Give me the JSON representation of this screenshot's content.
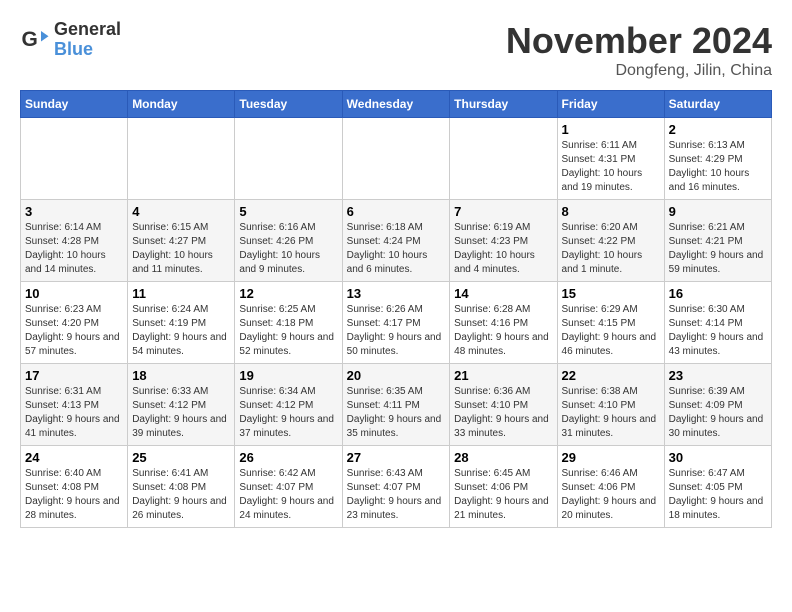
{
  "header": {
    "logo_line1": "General",
    "logo_line2": "Blue",
    "month_title": "November 2024",
    "subtitle": "Dongfeng, Jilin, China"
  },
  "weekdays": [
    "Sunday",
    "Monday",
    "Tuesday",
    "Wednesday",
    "Thursday",
    "Friday",
    "Saturday"
  ],
  "weeks": [
    [
      {
        "day": "",
        "info": ""
      },
      {
        "day": "",
        "info": ""
      },
      {
        "day": "",
        "info": ""
      },
      {
        "day": "",
        "info": ""
      },
      {
        "day": "",
        "info": ""
      },
      {
        "day": "1",
        "info": "Sunrise: 6:11 AM\nSunset: 4:31 PM\nDaylight: 10 hours and 19 minutes."
      },
      {
        "day": "2",
        "info": "Sunrise: 6:13 AM\nSunset: 4:29 PM\nDaylight: 10 hours and 16 minutes."
      }
    ],
    [
      {
        "day": "3",
        "info": "Sunrise: 6:14 AM\nSunset: 4:28 PM\nDaylight: 10 hours and 14 minutes."
      },
      {
        "day": "4",
        "info": "Sunrise: 6:15 AM\nSunset: 4:27 PM\nDaylight: 10 hours and 11 minutes."
      },
      {
        "day": "5",
        "info": "Sunrise: 6:16 AM\nSunset: 4:26 PM\nDaylight: 10 hours and 9 minutes."
      },
      {
        "day": "6",
        "info": "Sunrise: 6:18 AM\nSunset: 4:24 PM\nDaylight: 10 hours and 6 minutes."
      },
      {
        "day": "7",
        "info": "Sunrise: 6:19 AM\nSunset: 4:23 PM\nDaylight: 10 hours and 4 minutes."
      },
      {
        "day": "8",
        "info": "Sunrise: 6:20 AM\nSunset: 4:22 PM\nDaylight: 10 hours and 1 minute."
      },
      {
        "day": "9",
        "info": "Sunrise: 6:21 AM\nSunset: 4:21 PM\nDaylight: 9 hours and 59 minutes."
      }
    ],
    [
      {
        "day": "10",
        "info": "Sunrise: 6:23 AM\nSunset: 4:20 PM\nDaylight: 9 hours and 57 minutes."
      },
      {
        "day": "11",
        "info": "Sunrise: 6:24 AM\nSunset: 4:19 PM\nDaylight: 9 hours and 54 minutes."
      },
      {
        "day": "12",
        "info": "Sunrise: 6:25 AM\nSunset: 4:18 PM\nDaylight: 9 hours and 52 minutes."
      },
      {
        "day": "13",
        "info": "Sunrise: 6:26 AM\nSunset: 4:17 PM\nDaylight: 9 hours and 50 minutes."
      },
      {
        "day": "14",
        "info": "Sunrise: 6:28 AM\nSunset: 4:16 PM\nDaylight: 9 hours and 48 minutes."
      },
      {
        "day": "15",
        "info": "Sunrise: 6:29 AM\nSunset: 4:15 PM\nDaylight: 9 hours and 46 minutes."
      },
      {
        "day": "16",
        "info": "Sunrise: 6:30 AM\nSunset: 4:14 PM\nDaylight: 9 hours and 43 minutes."
      }
    ],
    [
      {
        "day": "17",
        "info": "Sunrise: 6:31 AM\nSunset: 4:13 PM\nDaylight: 9 hours and 41 minutes."
      },
      {
        "day": "18",
        "info": "Sunrise: 6:33 AM\nSunset: 4:12 PM\nDaylight: 9 hours and 39 minutes."
      },
      {
        "day": "19",
        "info": "Sunrise: 6:34 AM\nSunset: 4:12 PM\nDaylight: 9 hours and 37 minutes."
      },
      {
        "day": "20",
        "info": "Sunrise: 6:35 AM\nSunset: 4:11 PM\nDaylight: 9 hours and 35 minutes."
      },
      {
        "day": "21",
        "info": "Sunrise: 6:36 AM\nSunset: 4:10 PM\nDaylight: 9 hours and 33 minutes."
      },
      {
        "day": "22",
        "info": "Sunrise: 6:38 AM\nSunset: 4:10 PM\nDaylight: 9 hours and 31 minutes."
      },
      {
        "day": "23",
        "info": "Sunrise: 6:39 AM\nSunset: 4:09 PM\nDaylight: 9 hours and 30 minutes."
      }
    ],
    [
      {
        "day": "24",
        "info": "Sunrise: 6:40 AM\nSunset: 4:08 PM\nDaylight: 9 hours and 28 minutes."
      },
      {
        "day": "25",
        "info": "Sunrise: 6:41 AM\nSunset: 4:08 PM\nDaylight: 9 hours and 26 minutes."
      },
      {
        "day": "26",
        "info": "Sunrise: 6:42 AM\nSunset: 4:07 PM\nDaylight: 9 hours and 24 minutes."
      },
      {
        "day": "27",
        "info": "Sunrise: 6:43 AM\nSunset: 4:07 PM\nDaylight: 9 hours and 23 minutes."
      },
      {
        "day": "28",
        "info": "Sunrise: 6:45 AM\nSunset: 4:06 PM\nDaylight: 9 hours and 21 minutes."
      },
      {
        "day": "29",
        "info": "Sunrise: 6:46 AM\nSunset: 4:06 PM\nDaylight: 9 hours and 20 minutes."
      },
      {
        "day": "30",
        "info": "Sunrise: 6:47 AM\nSunset: 4:05 PM\nDaylight: 9 hours and 18 minutes."
      }
    ]
  ]
}
